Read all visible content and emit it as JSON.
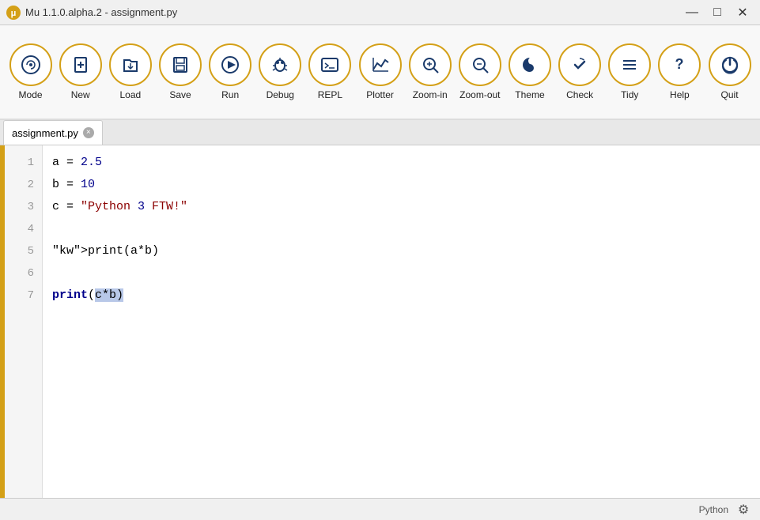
{
  "titlebar": {
    "logo_alt": "Mu logo",
    "title": "Mu 1.1.0.alpha.2 - assignment.py",
    "minimize": "—",
    "maximize": "□",
    "close": "✕"
  },
  "toolbar": {
    "buttons": [
      {
        "id": "mode",
        "label": "Mode",
        "icon": "🐍"
      },
      {
        "id": "new",
        "label": "New",
        "icon": "+"
      },
      {
        "id": "load",
        "label": "Load",
        "icon": "📂"
      },
      {
        "id": "save",
        "label": "Save",
        "icon": "💾"
      },
      {
        "id": "run",
        "label": "Run",
        "icon": "▶"
      },
      {
        "id": "debug",
        "label": "Debug",
        "icon": "🐞"
      },
      {
        "id": "repl",
        "label": "REPL",
        "icon": "⌨"
      },
      {
        "id": "plotter",
        "label": "Plotter",
        "icon": "📈"
      },
      {
        "id": "zoom-in",
        "label": "Zoom-in",
        "icon": "🔍"
      },
      {
        "id": "zoom-out",
        "label": "Zoom-out",
        "icon": "🔍"
      },
      {
        "id": "theme",
        "label": "Theme",
        "icon": "🌙"
      },
      {
        "id": "check",
        "label": "Check",
        "icon": "👍"
      },
      {
        "id": "tidy",
        "label": "Tidy",
        "icon": "☰"
      },
      {
        "id": "help",
        "label": "Help",
        "icon": "?"
      },
      {
        "id": "quit",
        "label": "Quit",
        "icon": "⏻"
      }
    ]
  },
  "tab": {
    "filename": "assignment.py",
    "close_label": "×"
  },
  "editor": {
    "lines": [
      {
        "num": "1",
        "content": "a = 2.5"
      },
      {
        "num": "2",
        "content": "b = 10"
      },
      {
        "num": "3",
        "content": "c = \"Python 3 FTW!\""
      },
      {
        "num": "4",
        "content": ""
      },
      {
        "num": "5",
        "content": "print(a*b)"
      },
      {
        "num": "6",
        "content": ""
      },
      {
        "num": "7",
        "content": "print(c*b)"
      }
    ]
  },
  "statusbar": {
    "mode": "Python",
    "gear_title": "Settings"
  }
}
